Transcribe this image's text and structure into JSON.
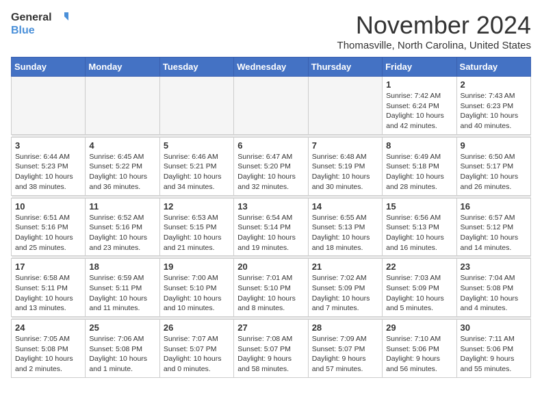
{
  "logo": {
    "line1": "General",
    "line2": "Blue"
  },
  "title": "November 2024",
  "location": "Thomasville, North Carolina, United States",
  "weekdays": [
    "Sunday",
    "Monday",
    "Tuesday",
    "Wednesday",
    "Thursday",
    "Friday",
    "Saturday"
  ],
  "weeks": [
    [
      {
        "day": "",
        "info": ""
      },
      {
        "day": "",
        "info": ""
      },
      {
        "day": "",
        "info": ""
      },
      {
        "day": "",
        "info": ""
      },
      {
        "day": "",
        "info": ""
      },
      {
        "day": "1",
        "info": "Sunrise: 7:42 AM\nSunset: 6:24 PM\nDaylight: 10 hours and 42 minutes."
      },
      {
        "day": "2",
        "info": "Sunrise: 7:43 AM\nSunset: 6:23 PM\nDaylight: 10 hours and 40 minutes."
      }
    ],
    [
      {
        "day": "3",
        "info": "Sunrise: 6:44 AM\nSunset: 5:23 PM\nDaylight: 10 hours and 38 minutes."
      },
      {
        "day": "4",
        "info": "Sunrise: 6:45 AM\nSunset: 5:22 PM\nDaylight: 10 hours and 36 minutes."
      },
      {
        "day": "5",
        "info": "Sunrise: 6:46 AM\nSunset: 5:21 PM\nDaylight: 10 hours and 34 minutes."
      },
      {
        "day": "6",
        "info": "Sunrise: 6:47 AM\nSunset: 5:20 PM\nDaylight: 10 hours and 32 minutes."
      },
      {
        "day": "7",
        "info": "Sunrise: 6:48 AM\nSunset: 5:19 PM\nDaylight: 10 hours and 30 minutes."
      },
      {
        "day": "8",
        "info": "Sunrise: 6:49 AM\nSunset: 5:18 PM\nDaylight: 10 hours and 28 minutes."
      },
      {
        "day": "9",
        "info": "Sunrise: 6:50 AM\nSunset: 5:17 PM\nDaylight: 10 hours and 26 minutes."
      }
    ],
    [
      {
        "day": "10",
        "info": "Sunrise: 6:51 AM\nSunset: 5:16 PM\nDaylight: 10 hours and 25 minutes."
      },
      {
        "day": "11",
        "info": "Sunrise: 6:52 AM\nSunset: 5:16 PM\nDaylight: 10 hours and 23 minutes."
      },
      {
        "day": "12",
        "info": "Sunrise: 6:53 AM\nSunset: 5:15 PM\nDaylight: 10 hours and 21 minutes."
      },
      {
        "day": "13",
        "info": "Sunrise: 6:54 AM\nSunset: 5:14 PM\nDaylight: 10 hours and 19 minutes."
      },
      {
        "day": "14",
        "info": "Sunrise: 6:55 AM\nSunset: 5:13 PM\nDaylight: 10 hours and 18 minutes."
      },
      {
        "day": "15",
        "info": "Sunrise: 6:56 AM\nSunset: 5:13 PM\nDaylight: 10 hours and 16 minutes."
      },
      {
        "day": "16",
        "info": "Sunrise: 6:57 AM\nSunset: 5:12 PM\nDaylight: 10 hours and 14 minutes."
      }
    ],
    [
      {
        "day": "17",
        "info": "Sunrise: 6:58 AM\nSunset: 5:11 PM\nDaylight: 10 hours and 13 minutes."
      },
      {
        "day": "18",
        "info": "Sunrise: 6:59 AM\nSunset: 5:11 PM\nDaylight: 10 hours and 11 minutes."
      },
      {
        "day": "19",
        "info": "Sunrise: 7:00 AM\nSunset: 5:10 PM\nDaylight: 10 hours and 10 minutes."
      },
      {
        "day": "20",
        "info": "Sunrise: 7:01 AM\nSunset: 5:10 PM\nDaylight: 10 hours and 8 minutes."
      },
      {
        "day": "21",
        "info": "Sunrise: 7:02 AM\nSunset: 5:09 PM\nDaylight: 10 hours and 7 minutes."
      },
      {
        "day": "22",
        "info": "Sunrise: 7:03 AM\nSunset: 5:09 PM\nDaylight: 10 hours and 5 minutes."
      },
      {
        "day": "23",
        "info": "Sunrise: 7:04 AM\nSunset: 5:08 PM\nDaylight: 10 hours and 4 minutes."
      }
    ],
    [
      {
        "day": "24",
        "info": "Sunrise: 7:05 AM\nSunset: 5:08 PM\nDaylight: 10 hours and 2 minutes."
      },
      {
        "day": "25",
        "info": "Sunrise: 7:06 AM\nSunset: 5:08 PM\nDaylight: 10 hours and 1 minute."
      },
      {
        "day": "26",
        "info": "Sunrise: 7:07 AM\nSunset: 5:07 PM\nDaylight: 10 hours and 0 minutes."
      },
      {
        "day": "27",
        "info": "Sunrise: 7:08 AM\nSunset: 5:07 PM\nDaylight: 9 hours and 58 minutes."
      },
      {
        "day": "28",
        "info": "Sunrise: 7:09 AM\nSunset: 5:07 PM\nDaylight: 9 hours and 57 minutes."
      },
      {
        "day": "29",
        "info": "Sunrise: 7:10 AM\nSunset: 5:06 PM\nDaylight: 9 hours and 56 minutes."
      },
      {
        "day": "30",
        "info": "Sunrise: 7:11 AM\nSunset: 5:06 PM\nDaylight: 9 hours and 55 minutes."
      }
    ]
  ]
}
